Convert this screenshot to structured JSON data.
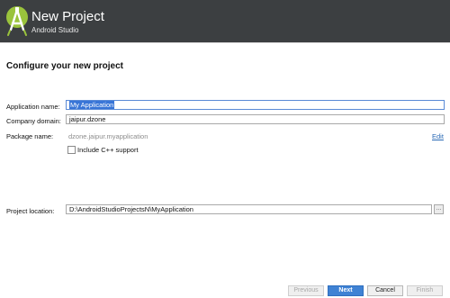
{
  "window": {
    "title": "New Project",
    "subtitle": "Android Studio"
  },
  "page": {
    "heading": "Configure your new project"
  },
  "form": {
    "application_name": {
      "label": "Application name:",
      "value": "My Application"
    },
    "company_domain": {
      "label": "Company domain:",
      "value": "jaipur.dzone"
    },
    "package_name": {
      "label": "Package name:",
      "value": "dzone.jaipur.myapplication",
      "edit_label": "Edit"
    },
    "include_cpp": {
      "label": "Include C++ support",
      "checked": false
    },
    "project_location": {
      "label": "Project location:",
      "value": "D:\\AndroidStudioProjectsN\\MyApplication",
      "browse_label": "..."
    }
  },
  "footer": {
    "previous": "Previous",
    "next": "Next",
    "cancel": "Cancel",
    "finish": "Finish"
  },
  "colors": {
    "header_bg": "#3c3f41",
    "accent": "#3f82d4",
    "logo_green": "#9ac33c"
  }
}
